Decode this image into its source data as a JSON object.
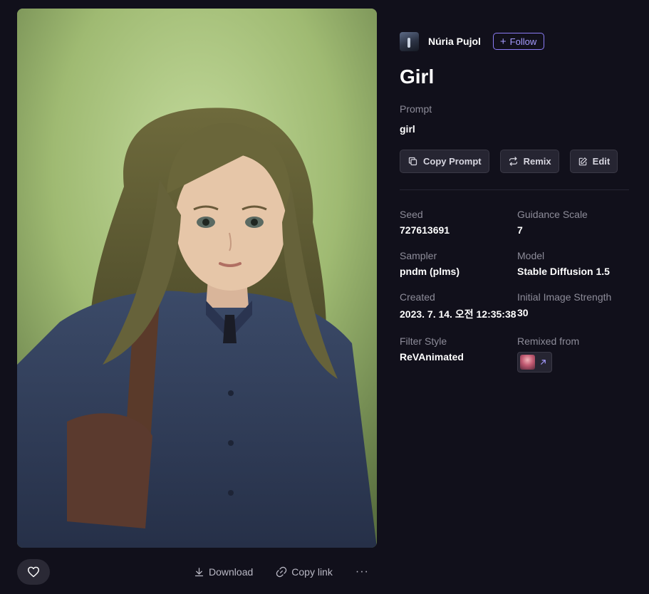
{
  "author": {
    "name": "Núria Pujol",
    "follow_label": "Follow"
  },
  "title": "Girl",
  "prompt": {
    "label": "Prompt",
    "text": "girl"
  },
  "actions": {
    "copy_prompt": "Copy Prompt",
    "remix": "Remix",
    "edit": "Edit"
  },
  "meta": {
    "seed": {
      "label": "Seed",
      "value": "727613691"
    },
    "guidance": {
      "label": "Guidance Scale",
      "value": "7"
    },
    "sampler": {
      "label": "Sampler",
      "value": "pndm (plms)"
    },
    "model": {
      "label": "Model",
      "value": "Stable Diffusion 1.5"
    },
    "created": {
      "label": "Created",
      "value": "2023. 7. 14. 오전 12:35:38"
    },
    "strength": {
      "label": "Initial Image Strength",
      "value": "30"
    },
    "filter": {
      "label": "Filter Style",
      "value": "ReVAnimated"
    },
    "remixed": {
      "label": "Remixed from"
    }
  },
  "bottom": {
    "download": "Download",
    "copy_link": "Copy link",
    "more": "···"
  },
  "icons": {
    "like": "heart-icon",
    "download": "download-icon",
    "copy_link": "link-icon",
    "copy_prompt": "copy-icon",
    "remix": "repeat-icon",
    "edit": "pencil-icon",
    "remixed_link": "arrow-up-right-icon"
  },
  "colors": {
    "background": "#11101b",
    "accent": "#8b7cf6",
    "muted_text": "#8d8c99",
    "button_bg": "#262532"
  }
}
